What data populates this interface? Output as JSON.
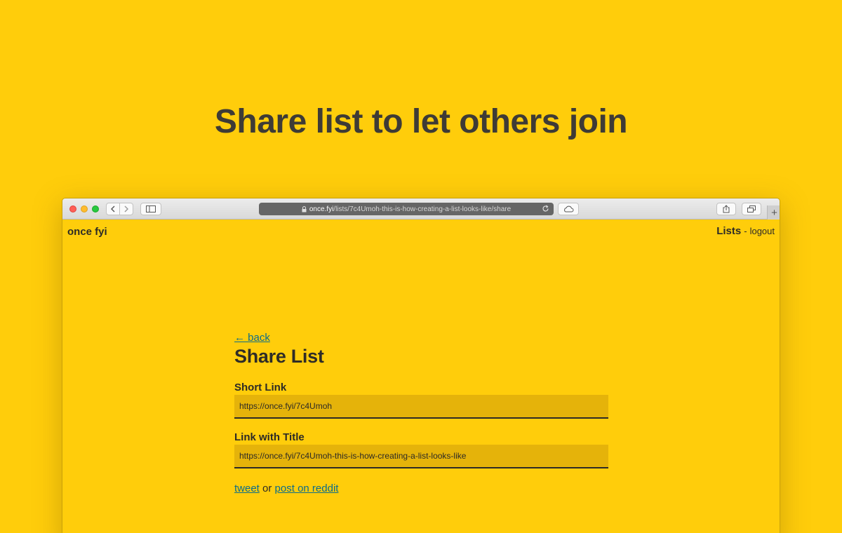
{
  "headline": "Share list to let others join",
  "browser": {
    "url_domain": "once.fyi",
    "url_path": "/lists/7c4Umoh-this-is-how-creating-a-list-looks-like/share",
    "plus_label": "+"
  },
  "site": {
    "brand": "once fyi",
    "nav": {
      "lists": "Lists",
      "separator": "-",
      "logout": "logout"
    }
  },
  "page": {
    "back": "← back",
    "title": "Share List",
    "short_link": {
      "label": "Short Link",
      "value": "https://once.fyi/7c4Umoh"
    },
    "title_link": {
      "label": "Link with Title",
      "value": "https://once.fyi/7c4Umoh-this-is-how-creating-a-list-looks-like"
    },
    "share": {
      "tweet": "tweet",
      "or": "or",
      "reddit": "post on reddit"
    }
  },
  "colors": {
    "background": "#FFCD0B",
    "input_background": "#E5B30A",
    "link": "#0a6c8a",
    "text": "#2c2a26"
  }
}
